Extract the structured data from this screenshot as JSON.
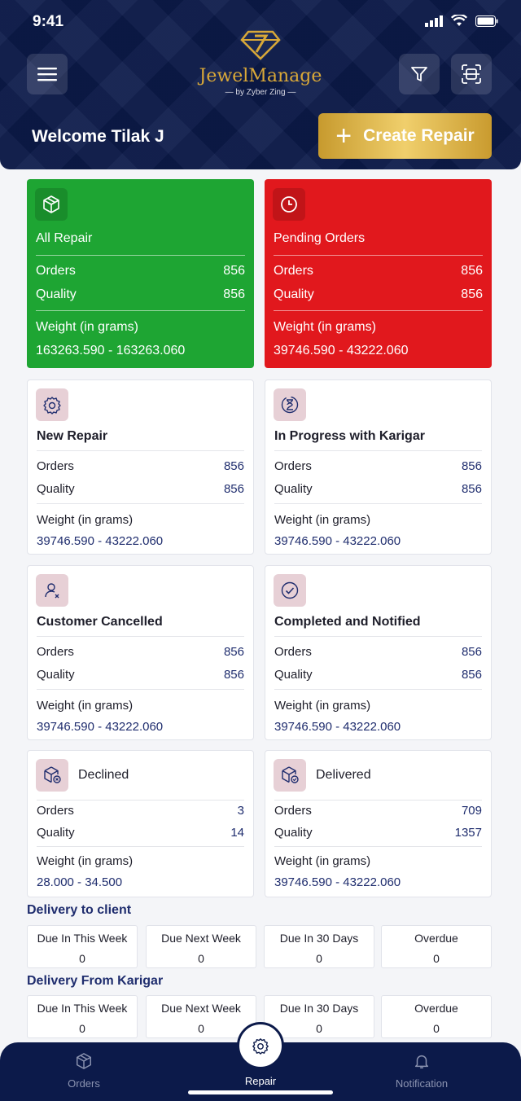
{
  "status": {
    "time": "9:41"
  },
  "header": {
    "app_name": "JewelManage",
    "byline": "— by Zyber Zing —",
    "welcome": "Welcome Tilak J",
    "create_label": "Create Repair",
    "menu_icon": "hamburger-icon",
    "filter_icon": "filter-icon",
    "scan_icon": "scan-icon"
  },
  "colors": {
    "navy": "#0c1a4a",
    "gold": "#d9a838",
    "green": "#1ea533",
    "red": "#e1181d",
    "value_blue": "#1f2d6e",
    "icon_bg": "#e7d0d6"
  },
  "cards": {
    "all_repair": {
      "title": "All Repair",
      "orders_label": "Orders",
      "orders": "856",
      "quality_label": "Quality",
      "quality": "856",
      "weight_label": "Weight (in grams)",
      "weight": "163263.590 - 163263.060",
      "icon": "box-icon"
    },
    "pending": {
      "title": "Pending Orders",
      "orders_label": "Orders",
      "orders": "856",
      "quality_label": "Quality",
      "quality": "856",
      "weight_label": "Weight (in grams)",
      "weight": "39746.590 - 43222.060",
      "icon": "clock-icon"
    },
    "new_repair": {
      "title": "New Repair",
      "orders_label": "Orders",
      "orders": "856",
      "quality_label": "Quality",
      "quality": "856",
      "weight_label": "Weight (in grams)",
      "weight": "39746.590 - 43222.060",
      "icon": "repair-gear-icon"
    },
    "in_progress": {
      "title": "In Progress with Karigar",
      "orders_label": "Orders",
      "orders": "856",
      "quality_label": "Quality",
      "quality": "856",
      "weight_label": "Weight (in grams)",
      "weight": "39746.590 - 43222.060",
      "icon": "hourglass-icon"
    },
    "cancelled": {
      "title": "Customer Cancelled",
      "orders_label": "Orders",
      "orders": "856",
      "quality_label": "Quality",
      "quality": "856",
      "weight_label": "Weight (in grams)",
      "weight": "39746.590 - 43222.060",
      "icon": "user-cancel-icon"
    },
    "completed": {
      "title": "Completed and Notified",
      "orders_label": "Orders",
      "orders": "856",
      "quality_label": "Quality",
      "quality": "856",
      "weight_label": "Weight (in grams)",
      "weight": "39746.590 - 43222.060",
      "icon": "check-circle-icon"
    },
    "declined": {
      "title": "Declined",
      "orders_label": "Orders",
      "orders": "3",
      "quality_label": "Quality",
      "quality": "14",
      "weight_label": "Weight (in grams)",
      "weight": "28.000 - 34.500",
      "icon": "box-declined-icon"
    },
    "delivered": {
      "title": "Delivered",
      "orders_label": "Orders",
      "orders": "709",
      "quality_label": "Quality",
      "quality": "1357",
      "weight_label": "Weight (in grams)",
      "weight": "39746.590 - 43222.060",
      "icon": "box-delivered-icon"
    }
  },
  "delivery_client": {
    "title": "Delivery to client",
    "tiles": [
      {
        "label": "Due In This Week",
        "value": "0"
      },
      {
        "label": "Due Next Week",
        "value": "0"
      },
      {
        "label": "Due In 30 Days",
        "value": "0"
      },
      {
        "label": "Overdue",
        "value": "0"
      }
    ]
  },
  "delivery_karigar": {
    "title": "Delivery From Karigar",
    "tiles": [
      {
        "label": "Due In This Week",
        "value": "0"
      },
      {
        "label": "Due Next Week",
        "value": "0"
      },
      {
        "label": "Due In 30 Days",
        "value": "0"
      },
      {
        "label": "Overdue",
        "value": "0"
      }
    ]
  },
  "nav": {
    "orders": "Orders",
    "repair": "Repair",
    "notification": "Notification"
  }
}
